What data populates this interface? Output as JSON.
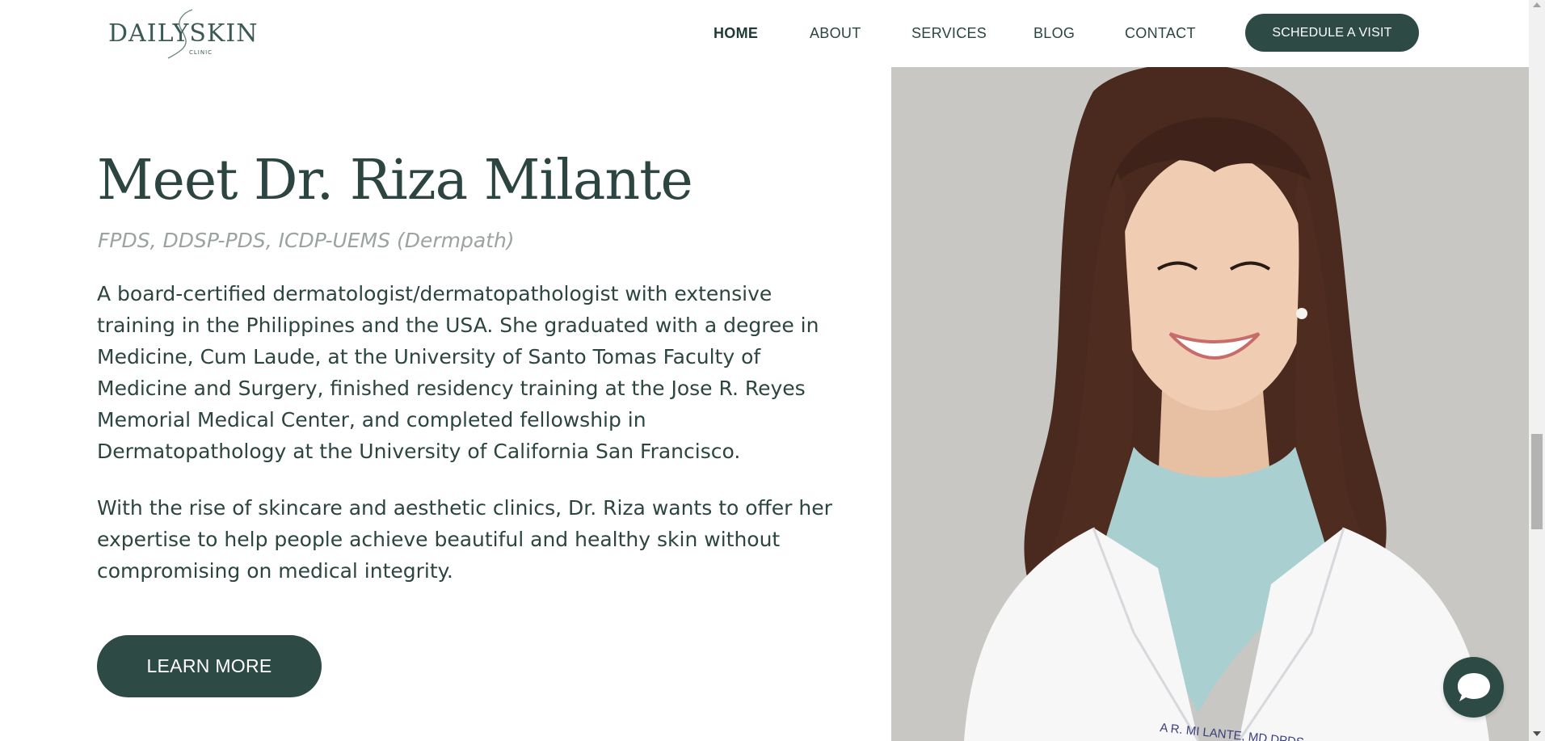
{
  "header": {
    "logo": {
      "word": "DAILYSKIN",
      "sub": "CLINIC"
    },
    "nav": [
      {
        "label": "HOME"
      },
      {
        "label": "ABOUT"
      },
      {
        "label": "SERVICES"
      },
      {
        "label": "BLOG"
      },
      {
        "label": "CONTACT"
      }
    ],
    "cta_label": "SCHEDULE A VISIT"
  },
  "main": {
    "title": "Meet Dr. Riza Milante",
    "credentials": "FPDS, DDSP-PDS, ICDP-UEMS (Dermpath)",
    "paragraph1": "A board-certified dermatologist/dermatopathologist with extensive training in the Philippines and the USA. She graduated with a degree in Medicine, Cum Laude, at the University of Santo Tomas Faculty of Medicine and Surgery, finished residency training at the Jose R. Reyes Memorial Medical Center, and completed fellowship in Dermatopathology at the University of California San Francisco.",
    "paragraph2": "With the rise of skincare and aesthetic clinics, Dr. Riza wants to offer her expertise to help people achieve beautiful and healthy skin without compromising on medical integrity.",
    "learn_more_label": "LEARN MORE"
  },
  "photo": {
    "badge_text": "A R. MI LANTE, MD,DPDS"
  },
  "icons": {
    "chat": "chat-bubble-icon"
  },
  "colors": {
    "accent": "#2d4a44",
    "text": "#2c4540",
    "muted": "#9ba39f",
    "photo_bg": "#c8c7c4"
  }
}
